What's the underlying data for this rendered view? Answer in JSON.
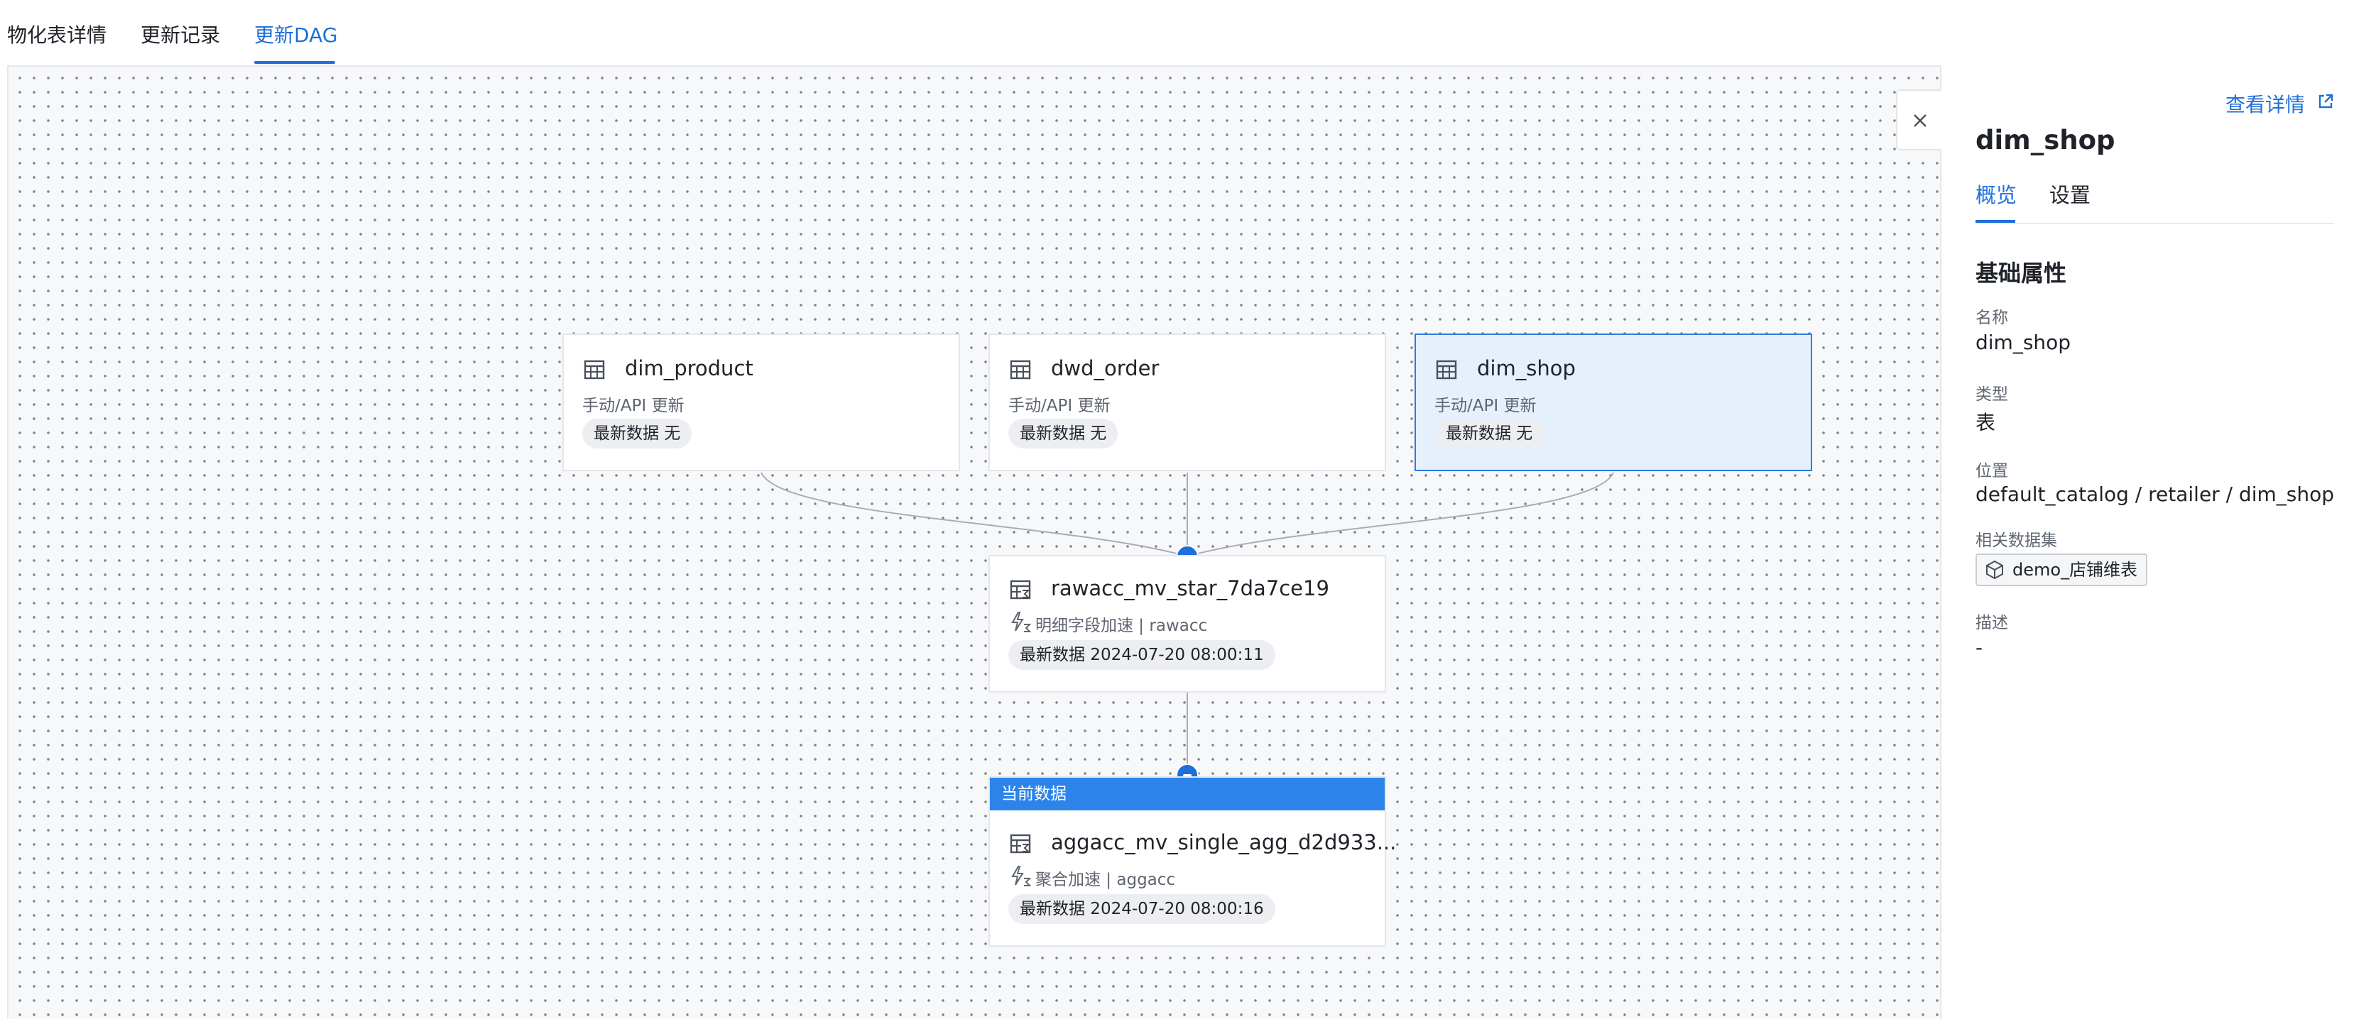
{
  "tabs": [
    {
      "label": "物化表详情"
    },
    {
      "label": "更新记录"
    },
    {
      "label": "更新DAG"
    }
  ],
  "nodes": {
    "dim_product": {
      "name": "dim_product",
      "update": "手动/API 更新",
      "latest": "最新数据 无"
    },
    "dwd_order": {
      "name": "dwd_order",
      "update": "手动/API 更新",
      "latest": "最新数据 无"
    },
    "dim_shop": {
      "name": "dim_shop",
      "update": "手动/API 更新",
      "latest": "最新数据 无"
    },
    "rawacc": {
      "name": "rawacc_mv_star_7da7ce19",
      "type": "明细字段加速 | rawacc",
      "latest": "最新数据 2024-07-20 08:00:11"
    },
    "aggacc": {
      "header": "当前数据",
      "name": "aggacc_mv_single_agg_d2d933...",
      "type": "聚合加速 | aggacc",
      "latest": "最新数据 2024-07-20 08:00:16"
    }
  },
  "panel": {
    "view_details": "查看详情",
    "title": "dim_shop",
    "tabs": [
      {
        "label": "概览"
      },
      {
        "label": "设置"
      }
    ],
    "section_title": "基础属性",
    "properties": {
      "name_label": "名称",
      "name_value": "dim_shop",
      "type_label": "类型",
      "type_value": "表",
      "location_label": "位置",
      "location_value": "default_catalog / retailer / dim_shop",
      "dataset_label": "相关数据集",
      "dataset_value": "demo_店铺维表",
      "desc_label": "描述",
      "desc_value": "-"
    }
  },
  "colors": {
    "accent": "#1e6fd9",
    "selected_bg": "#e6f0fc",
    "current_header": "#2c84ea"
  },
  "icons": [
    "table-icon",
    "materialized-view-icon",
    "acceleration-icon",
    "collapse-icon",
    "close-icon",
    "external-link-icon",
    "dataset-cube-icon"
  ]
}
